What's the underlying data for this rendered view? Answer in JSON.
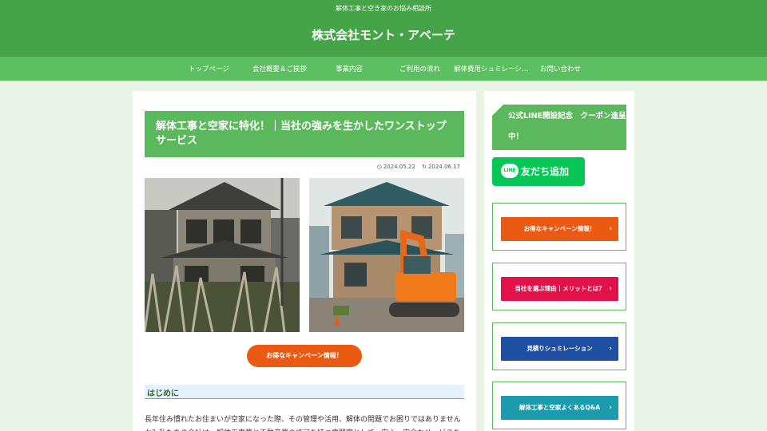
{
  "header": {
    "tagline": "解体工事と空き家のお悩み相談所",
    "site_title": "株式会社モント・アベーテ"
  },
  "nav": {
    "items": [
      "トップページ",
      "会社概要＆ご挨拶",
      "事業内容",
      "ご利用の流れ",
      "解体費用シュミレーシ…",
      "お問い合わせ"
    ]
  },
  "article": {
    "title": "解体工事と空家に特化！｜当社の強みを生かしたワンストップサービス",
    "published": "2024.05.22",
    "updated": "2024.06.17",
    "cta_label": "お得なキャンペーン情報！",
    "section_heading": "はじめに",
    "body_text": "長年住み慣れたお住まいが空家になった際、その管理や活用、解体の問題でお困りではありませんか？私たちの会社は、解体工事業と不動産業の許可を持つ専門家として、安心・安全なサービスを"
  },
  "sidebar": {
    "line_banner": "公式LINE開設記念　クーポン進呈中！",
    "line_logo": "LINE",
    "friend_button": "友だち追加",
    "cards": [
      {
        "label": "お得なキャンペーン情報！",
        "color": "#ea5a12"
      },
      {
        "label": "当社を選ぶ理由｜メリットとは？",
        "color": "#e3114a"
      },
      {
        "label": "見積りシュミレーション",
        "color": "#1e4fa3"
      },
      {
        "label": "解体工事と空家よくあるQ&A",
        "color": "#1a9cae"
      }
    ]
  },
  "colors": {
    "brand_green": "#45a348",
    "nav_green": "#5cbf60"
  }
}
